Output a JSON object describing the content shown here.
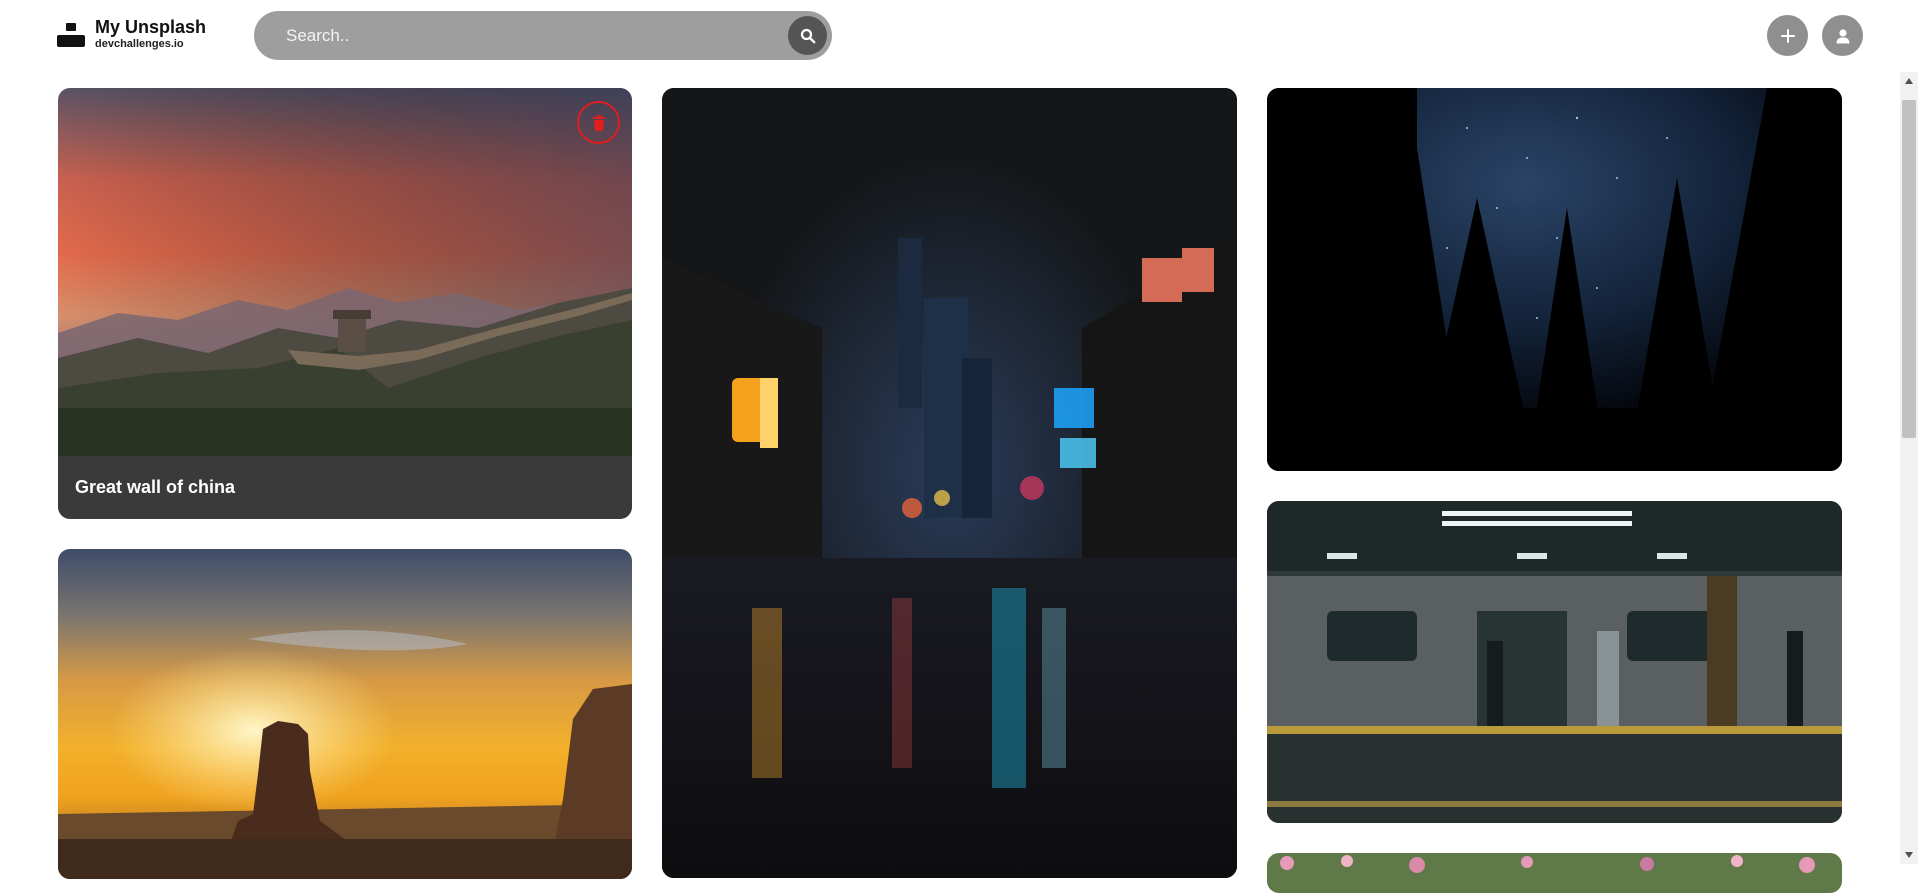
{
  "header": {
    "title": "My Unsplash",
    "subtitle": "devchallenges.io",
    "search_placeholder": "Search..",
    "icons": {
      "logo": "logo-mark",
      "search": "search-icon",
      "add": "plus-icon",
      "user": "user-icon"
    }
  },
  "gallery": {
    "images": [
      {
        "id": "great-wall",
        "label": "Great wall of china",
        "has_delete": true
      },
      {
        "id": "desert",
        "label": ""
      },
      {
        "id": "city-night",
        "label": ""
      },
      {
        "id": "starry-forest",
        "label": ""
      },
      {
        "id": "subway",
        "label": ""
      },
      {
        "id": "flowers",
        "label": ""
      }
    ]
  },
  "colors": {
    "search_bg": "#9e9e9e",
    "search_button": "#555555",
    "header_button": "#8f8f8f",
    "delete": "#e01e1e",
    "caption_bg": "#3a3a3a"
  }
}
